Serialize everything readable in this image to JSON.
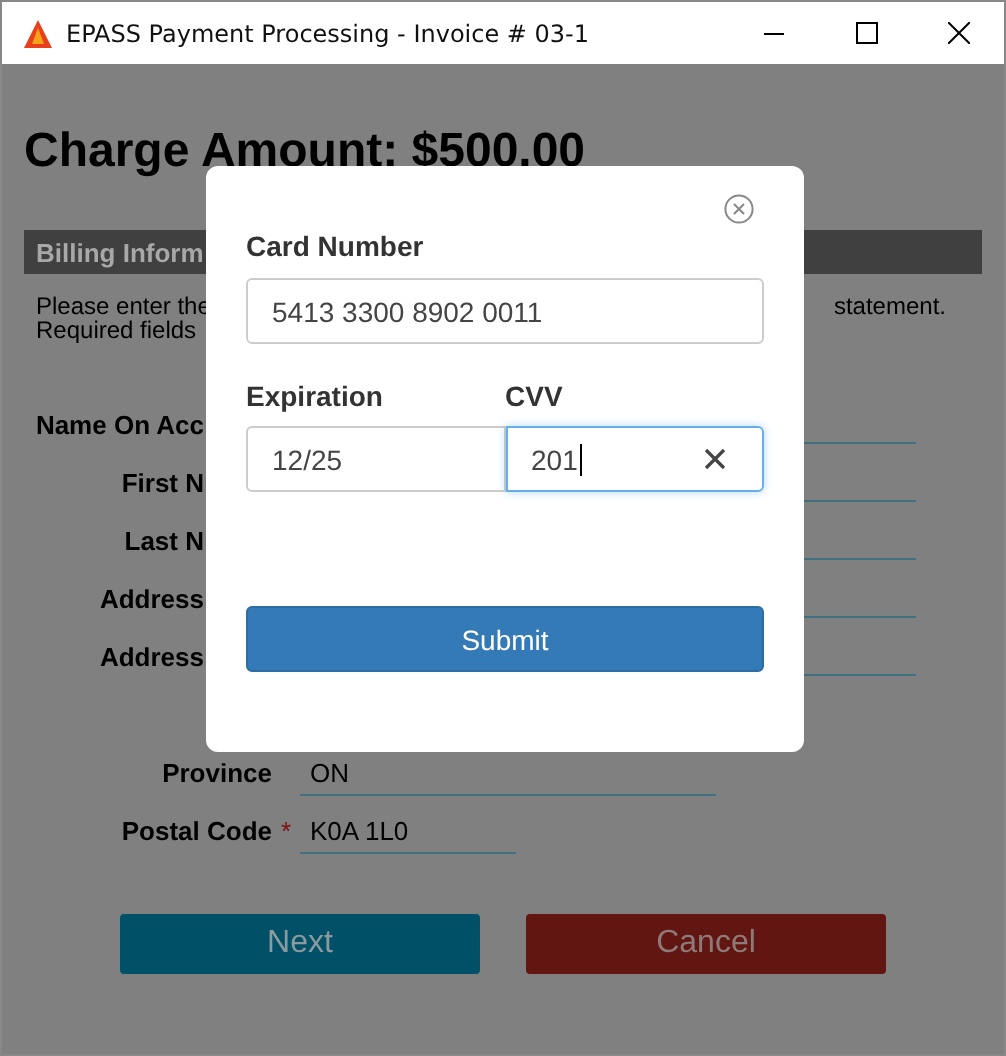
{
  "window": {
    "title": "EPASS Payment Processing - Invoice # 03-1"
  },
  "page": {
    "heading": "Charge Amount: $500.00",
    "section_title": "Billing Inform",
    "intro_left": [
      "Please enter the",
      "Required fields"
    ],
    "intro_right": "statement.",
    "rows": [
      {
        "kind": "covered",
        "label": "Name On Acc"
      },
      {
        "kind": "covered",
        "label": "First N"
      },
      {
        "kind": "covered",
        "label": "Last N"
      },
      {
        "kind": "covered",
        "label": "Address"
      },
      {
        "kind": "covered",
        "label": "Address"
      },
      {
        "kind": "field",
        "label": "Province",
        "value": "ON"
      },
      {
        "kind": "field",
        "label": "Postal Code",
        "required_mark": "*",
        "value": "K0A 1L0"
      }
    ],
    "buttons": [
      {
        "kind": "primary",
        "label": "Next"
      },
      {
        "kind": "danger",
        "label": "Cancel"
      }
    ]
  },
  "dialog": {
    "card_number": {
      "label": "Card Number",
      "value": "5413 3300 8902 0011"
    },
    "expiration": {
      "label": "Expiration",
      "value": "12/25",
      "focused": false
    },
    "cvv": {
      "label": "CVV",
      "value": "201",
      "focused": true
    },
    "submit": "Submit"
  }
}
